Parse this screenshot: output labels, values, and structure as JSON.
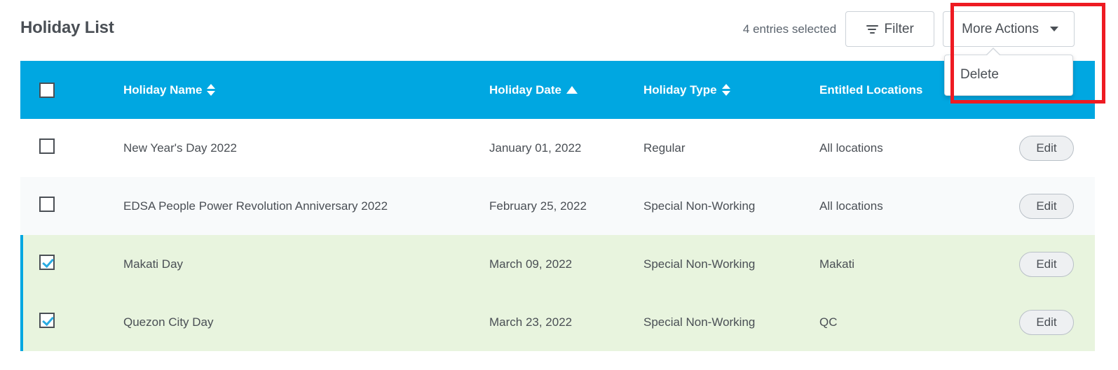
{
  "header": {
    "title": "Holiday List",
    "entries_selected": "4 entries selected",
    "filter_label": "Filter",
    "more_actions_label": "More Actions"
  },
  "dropdown": {
    "items": [
      {
        "label": "Delete"
      }
    ]
  },
  "table": {
    "columns": [
      {
        "label": "",
        "sort": "none"
      },
      {
        "label": "Holiday Name",
        "sort": "both"
      },
      {
        "label": "Holiday Date",
        "sort": "asc"
      },
      {
        "label": "Holiday Type",
        "sort": "both"
      },
      {
        "label": "Entitled Locations",
        "sort": "none"
      },
      {
        "label": "",
        "sort": "none"
      }
    ],
    "header_checkbox_checked": false,
    "row_action_label": "Edit",
    "rows": [
      {
        "checked": false,
        "name": "New Year's Day 2022",
        "date": "January 01, 2022",
        "type": "Regular",
        "locations": "All locations",
        "action": "Edit"
      },
      {
        "checked": false,
        "name": "EDSA People Power Revolution Anniversary 2022",
        "date": "February 25, 2022",
        "type": "Special Non-Working",
        "locations": "All locations",
        "action": "Edit"
      },
      {
        "checked": true,
        "name": "Makati Day",
        "date": "March 09, 2022",
        "type": "Special Non-Working",
        "locations": "Makati",
        "action": "Edit"
      },
      {
        "checked": true,
        "name": "Quezon City Day",
        "date": "March 23, 2022",
        "type": "Special Non-Working",
        "locations": "QC",
        "action": "Edit"
      }
    ]
  },
  "colors": {
    "header_blue": "#00a7e1",
    "selected_green": "#e8f4de",
    "annotation_red": "#ee1b22",
    "alt_row": "#f8fafb",
    "text": "#4a4f55"
  }
}
